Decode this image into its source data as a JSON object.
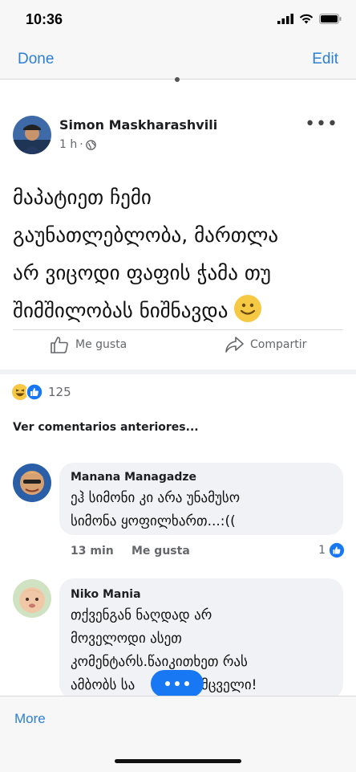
{
  "status": {
    "time": "10:36"
  },
  "nav": {
    "done_label": "Done",
    "edit_label": "Edit"
  },
  "post": {
    "author": "Simon Maskharashvili",
    "time": "1 h",
    "separator": "·",
    "more": "•••",
    "text_lines": [
      "მაპატიეთ ჩემი",
      "გაუნათლებლობა, მართლა",
      "არ ვიცოდი ფაფის ჭამა თუ",
      "შიმშილობას ნიშნავდა"
    ]
  },
  "actions": {
    "like_label": "Me gusta",
    "share_label": "Compartir"
  },
  "reactions": {
    "count": "125"
  },
  "comments_header": "Ver comentarios anteriores...",
  "comments": [
    {
      "name": "Manana Managadze",
      "lines": [
        "ეჰ სიმონი კი არა უნამუსო",
        "სიმონა ყოფილხართ...:(("
      ],
      "time": "13 min",
      "like_label": "Me gusta",
      "like_count": "1"
    },
    {
      "name": "Niko Mania",
      "lines": [
        "თქვენგან ნაღდად არ",
        "მოველოდი ასეთ",
        "კომენტარს.წაიკითხეთ რას",
        "ამბობს სა",
        "დამცველი!"
      ]
    }
  ],
  "bottom": {
    "more_label": "More"
  },
  "colors": {
    "accent": "#2d7fd6",
    "facebook_blue": "#1877f2",
    "bubble": "#f0f2f5"
  }
}
